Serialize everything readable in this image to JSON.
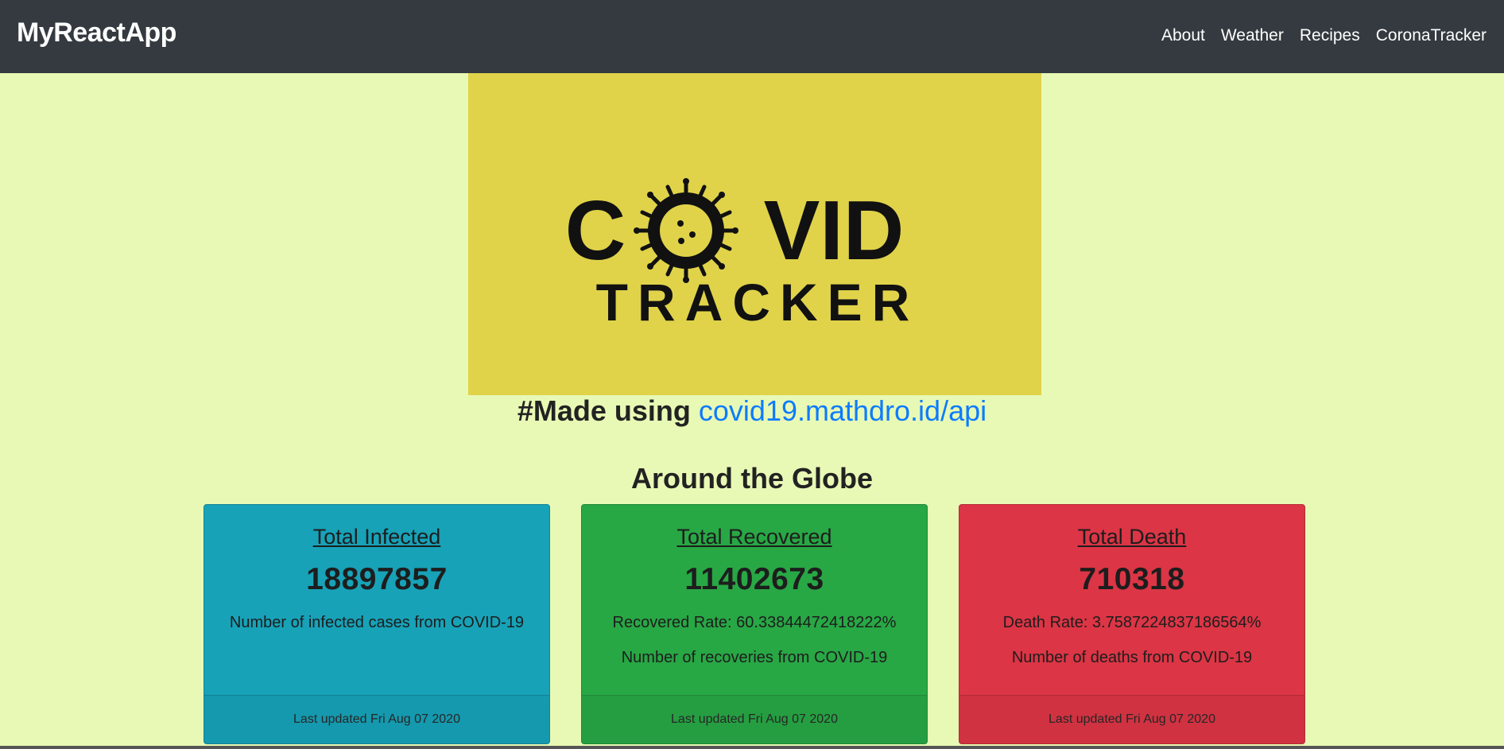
{
  "navbar": {
    "brand": "MyReactApp",
    "links": [
      "About",
      "Weather",
      "Recipes",
      "CoronaTracker"
    ]
  },
  "hero": {
    "line1": "C",
    "line1_rest": "VID",
    "line2": "TRACKER",
    "background_color": "#e0d34a"
  },
  "made_using": {
    "prefix": "#Made using ",
    "link": "covid19.mathdro.id/api"
  },
  "globe": {
    "heading": "Around the Globe"
  },
  "cards": [
    {
      "title": "Total Infected",
      "value": "18897857",
      "lines": [
        "Number of infected cases from COVID-19"
      ],
      "footer": "Last updated Fri Aug 07 2020",
      "color": "#17a2b8"
    },
    {
      "title": "Total Recovered",
      "value": "11402673",
      "lines": [
        "Recovered Rate: 60.33844472418222%",
        "Number of recoveries from COVID-19"
      ],
      "footer": "Last updated Fri Aug 07 2020",
      "color": "#28a745"
    },
    {
      "title": "Total Death",
      "value": "710318",
      "lines": [
        "Death Rate: 3.7587224837186564%",
        "Number of deaths from COVID-19"
      ],
      "footer": "Last updated Fri Aug 07 2020",
      "color": "#dc3545"
    }
  ]
}
